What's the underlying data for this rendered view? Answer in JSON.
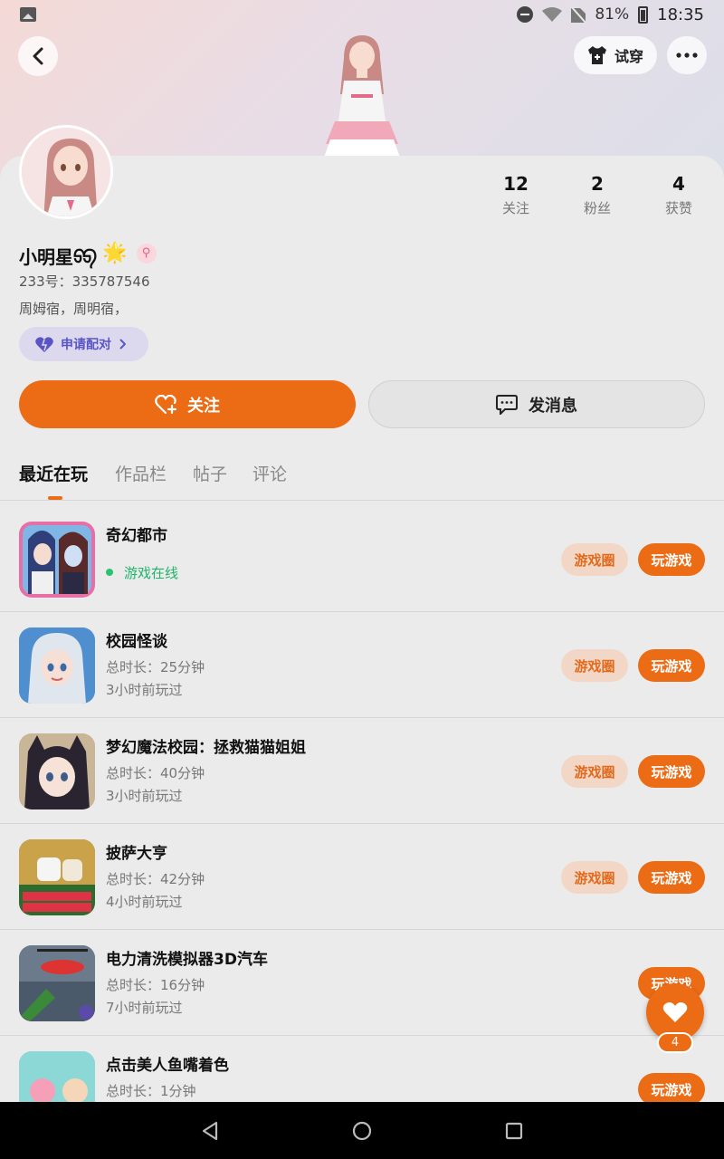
{
  "status_bar": {
    "battery": "81%",
    "time": "18:35"
  },
  "header": {
    "tryon_label": "试穿"
  },
  "profile": {
    "name": "小明星ᢒᢒ",
    "star": "🌟",
    "gender_symbol": "⚲",
    "uid": "233号：335787546",
    "bio": "周姆宿，周明宿，",
    "pair_label": "申请配对"
  },
  "stats": [
    {
      "num": "12",
      "label": "关注"
    },
    {
      "num": "2",
      "label": "粉丝"
    },
    {
      "num": "4",
      "label": "获赞"
    }
  ],
  "actions": {
    "follow_label": "关注",
    "message_label": "发消息"
  },
  "tabs": [
    "最近在玩",
    "作品栏",
    "帖子",
    "评论"
  ],
  "buttons": {
    "circle_label": "游戏圈",
    "play_label": "玩游戏"
  },
  "games": [
    {
      "title": "奇幻都市",
      "line1": "游戏在线",
      "line2": ""
    },
    {
      "title": "校园怪谈",
      "line1": "总时长：25分钟",
      "line2": "3小时前玩过"
    },
    {
      "title": "梦幻魔法校园：拯救猫猫姐姐",
      "line1": "总时长：40分钟",
      "line2": "3小时前玩过"
    },
    {
      "title": "披萨大亨",
      "line1": "总时长：42分钟",
      "line2": "4小时前玩过"
    },
    {
      "title": "电力清洗模拟器3D汽车",
      "line1": "总时长：16分钟",
      "line2": "7小时前玩过"
    },
    {
      "title": "点击美人鱼嘴着色",
      "line1": "总时长：1分钟",
      "line2": ""
    }
  ],
  "fab": {
    "count": "4"
  },
  "colors": {
    "accent": "#ec6b15",
    "online": "#21b36a",
    "pair": "#5b55c4"
  }
}
